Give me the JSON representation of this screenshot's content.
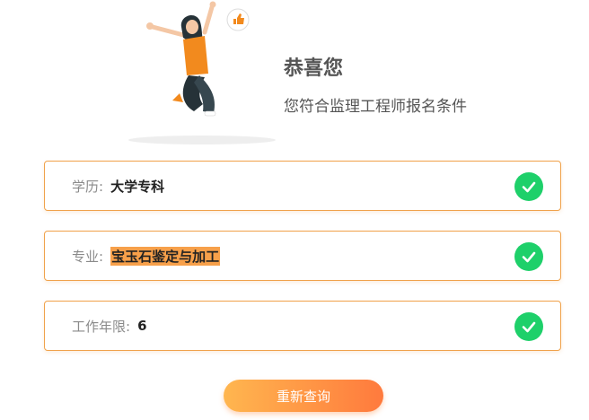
{
  "header": {
    "title": "恭喜您",
    "subtitle": "您符合监理工程师报名条件"
  },
  "criteria": [
    {
      "label": "学历:",
      "value": "大学专科",
      "highlight": false
    },
    {
      "label": "专业:",
      "value": "宝玉石鉴定与加工",
      "highlight": true
    },
    {
      "label": "工作年限:",
      "value": "6",
      "highlight": false
    }
  ],
  "actions": {
    "requery_label": "重新查询"
  },
  "colors": {
    "accent": "#f7a04a",
    "card_border": "#f0a24b",
    "success": "#1ed06a",
    "button_start": "#ffb64f",
    "button_end": "#ff7a3d"
  },
  "icons": {
    "thumbs_up": "thumbs-up-icon",
    "check": "check-circle-icon"
  }
}
